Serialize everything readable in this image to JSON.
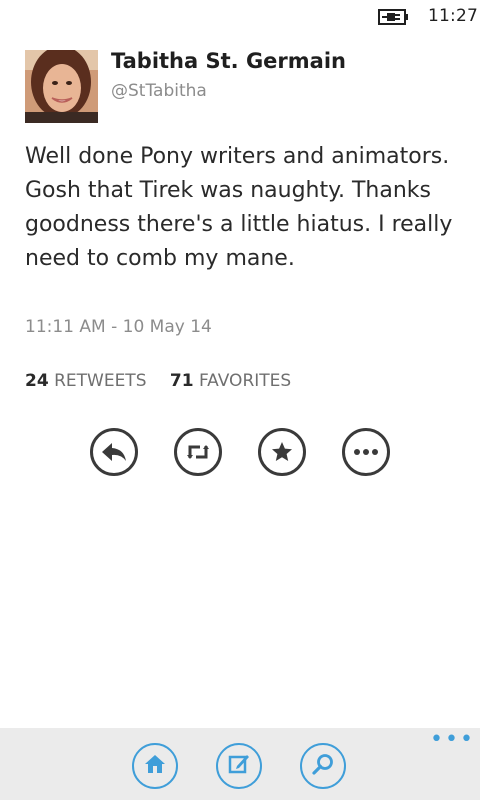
{
  "status_bar": {
    "time": "11:27",
    "battery_icon": "battery-charging-icon"
  },
  "profile": {
    "display_name": "Tabitha St. Germain",
    "handle": "@StTabitha",
    "avatar_icon": "profile-photo"
  },
  "tweet": {
    "text": "Well done Pony writers and animators. Gosh that Tirek was naughty. Thanks goodness there's a little hiatus. I really need to comb my mane.",
    "timestamp": "11:11 AM - 10 May 14"
  },
  "stats": {
    "retweets_count": "24",
    "retweets_label": "RETWEETS",
    "favorites_count": "71",
    "favorites_label": "FAVORITES"
  },
  "actions": [
    {
      "name": "reply",
      "icon": "reply-icon"
    },
    {
      "name": "retweet",
      "icon": "retweet-icon"
    },
    {
      "name": "favorite",
      "icon": "star-icon"
    },
    {
      "name": "more",
      "icon": "more-icon"
    }
  ],
  "app_bar": {
    "buttons": [
      {
        "name": "home",
        "icon": "home-icon"
      },
      {
        "name": "compose",
        "icon": "compose-icon"
      },
      {
        "name": "search",
        "icon": "search-icon"
      }
    ],
    "more_label": "•••",
    "accent": "#3f9ed9"
  }
}
